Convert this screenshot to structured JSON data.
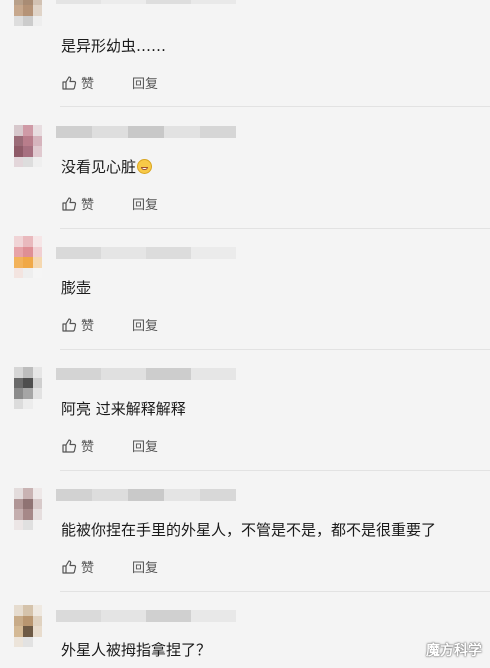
{
  "comments": [
    {
      "text": "是异形幼虫……",
      "like_label": "赞",
      "reply_label": "回复",
      "emoji": ""
    },
    {
      "text": "没看见心脏",
      "like_label": "赞",
      "reply_label": "回复",
      "emoji": "grinning-emoji-icon"
    },
    {
      "text": "膨壶",
      "like_label": "赞",
      "reply_label": "回复",
      "emoji": ""
    },
    {
      "text": "阿亮 过来解释解释",
      "like_label": "赞",
      "reply_label": "回复",
      "emoji": ""
    },
    {
      "text": "能被你捏在手里的外星人，不管是不是，都不是很重要了",
      "like_label": "赞",
      "reply_label": "回复",
      "emoji": ""
    },
    {
      "text": "外星人被拇指拿捏了？",
      "like_label": "",
      "reply_label": "",
      "emoji": ""
    }
  ],
  "watermark": "魔方科学",
  "colors": {
    "background": "#f4f4f4",
    "text": "#1a1a1a",
    "action_text": "#555555",
    "divider": "#e2e2e2"
  }
}
